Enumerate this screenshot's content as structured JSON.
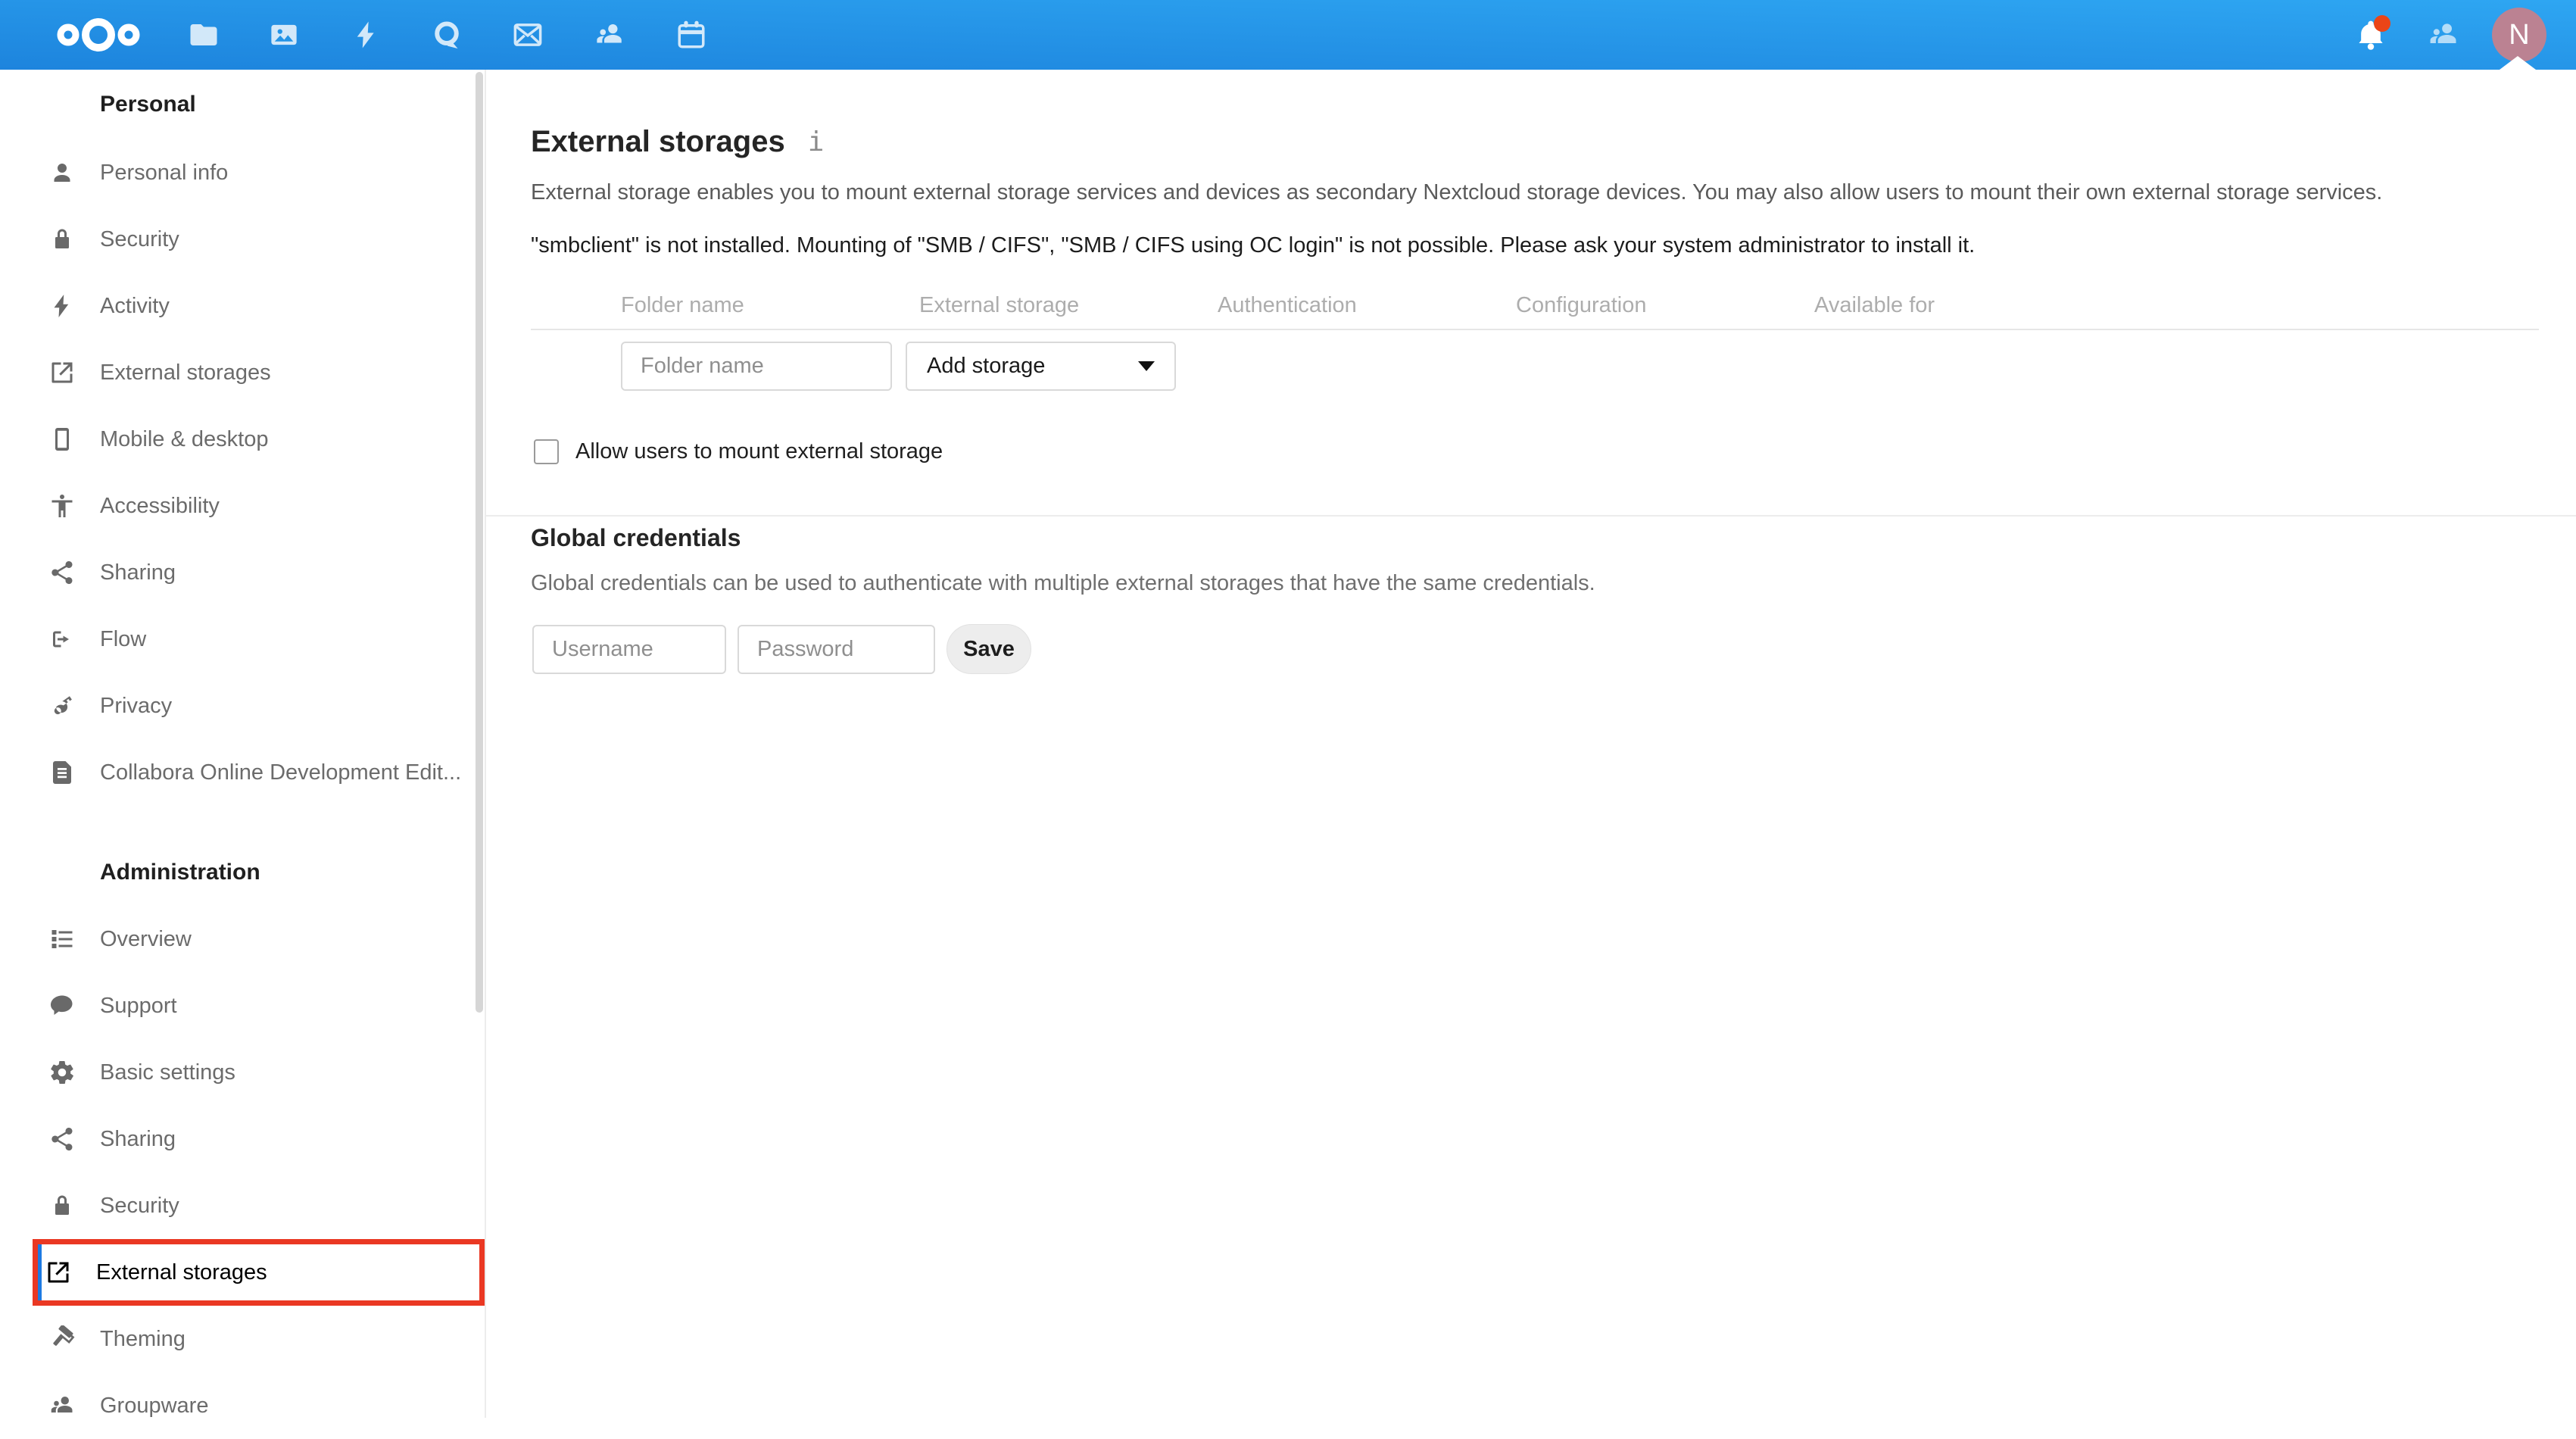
{
  "header": {
    "avatar_letter": "N",
    "app_icons": [
      "files-icon",
      "photos-icon",
      "activity-icon",
      "talk-icon",
      "mail-icon",
      "contacts-icon",
      "calendar-icon"
    ],
    "right_icons": [
      "notifications-bell-icon",
      "contacts-menu-icon",
      "avatar"
    ]
  },
  "sidebar": {
    "sections": [
      {
        "title": "Personal",
        "items": [
          {
            "label": "Personal info",
            "icon": "user-icon"
          },
          {
            "label": "Security",
            "icon": "lock-icon"
          },
          {
            "label": "Activity",
            "icon": "bolt-icon"
          },
          {
            "label": "External storages",
            "icon": "external-storage-icon"
          },
          {
            "label": "Mobile & desktop",
            "icon": "phone-icon"
          },
          {
            "label": "Accessibility",
            "icon": "accessibility-icon"
          },
          {
            "label": "Sharing",
            "icon": "share-icon"
          },
          {
            "label": "Flow",
            "icon": "flow-icon"
          },
          {
            "label": "Privacy",
            "icon": "key-icon"
          },
          {
            "label": "Collabora Online Development Edit...",
            "icon": "document-icon"
          }
        ]
      },
      {
        "title": "Administration",
        "items": [
          {
            "label": "Overview",
            "icon": "overview-list-icon"
          },
          {
            "label": "Support",
            "icon": "chat-bubble-icon"
          },
          {
            "label": "Basic settings",
            "icon": "gear-icon"
          },
          {
            "label": "Sharing",
            "icon": "share-icon"
          },
          {
            "label": "Security",
            "icon": "lock-icon"
          },
          {
            "label": "External storages",
            "icon": "external-storage-icon",
            "active": true,
            "highlighted": true
          },
          {
            "label": "Theming",
            "icon": "paint-roller-icon"
          },
          {
            "label": "Groupware",
            "icon": "people-icon"
          }
        ]
      }
    ]
  },
  "main": {
    "title": "External storages",
    "info_glyph": "i",
    "description": "External storage enables you to mount external storage services and devices as secondary Nextcloud storage devices. You may also allow users to mount their own external storage services.",
    "warning": "\"smbclient\" is not installed. Mounting of \"SMB / CIFS\", \"SMB / CIFS using OC login\" is not possible. Please ask your system administrator to install it.",
    "table": {
      "headers": [
        "Folder name",
        "External storage",
        "Authentication",
        "Configuration",
        "Available for"
      ]
    },
    "form": {
      "folder_placeholder": "Folder name",
      "add_storage_label": "Add storage"
    },
    "checkbox_label": "Allow users to mount external storage",
    "checkbox_checked": false,
    "global_credentials": {
      "title": "Global credentials",
      "description": "Global credentials can be used to authenticate with multiple external storages that have the same credentials.",
      "username_placeholder": "Username",
      "password_placeholder": "Password",
      "save_label": "Save"
    }
  },
  "colors": {
    "header_gradient_start": "#1d84dd",
    "header_gradient_end": "#2ea6f2",
    "highlight_box_red": "#ea3823",
    "active_indicator_blue": "#1d7ae2",
    "avatar_background": "#bb8292",
    "notification_dot": "#eb4517"
  }
}
